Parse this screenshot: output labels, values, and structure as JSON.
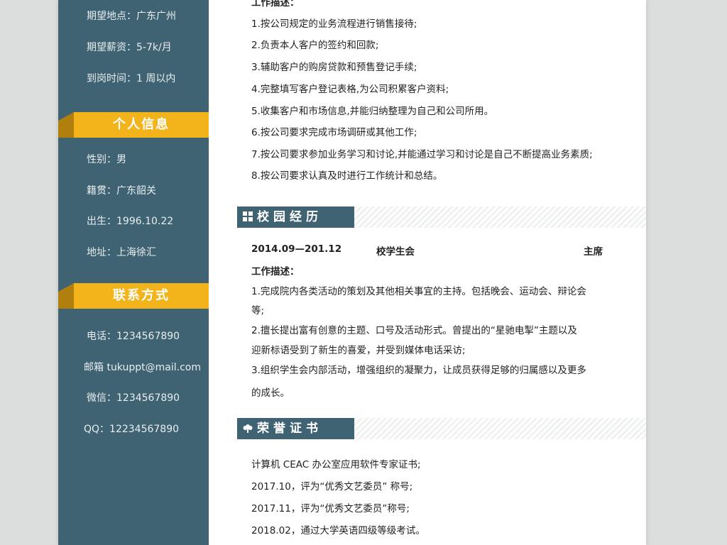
{
  "sidebar": {
    "intent": [
      "期望地点：广东广州",
      "期望薪资：5-7k/月",
      "到岗时间：1 周以内"
    ],
    "personal_title": "个人信息",
    "personal": [
      "性别：男",
      "籍贯：广东韶关",
      "出生：1996.10.22",
      "地址：上海徐汇"
    ],
    "contact_title": "联系方式",
    "contact": [
      "电话：1234567890",
      "邮箱 tukuppt@mail.com",
      "微信：1234567890",
      "QQ：12234567890"
    ]
  },
  "work": {
    "desc_title": "工作描述：",
    "items": [
      "1.按公司规定的业务流程进行销售接待;",
      "2.负责本人客户的签约和回款;",
      "3.辅助客户的购房贷款和预售登记手续;",
      "4.完整填写客户登记表格,为公司积累客户资料;",
      "5.收集客户和市场信息,并能归纳整理为自己和公司所用。",
      "6.按公司要求完成市场调研或其他工作;",
      "7.按公司要求参加业务学习和讨论,并能通过学习和讨论是自己不断提高业务素质;",
      "8.按公司要求认真及时进行工作统计和总结。"
    ]
  },
  "campus": {
    "title": "校园经历",
    "period": "2014.09—201.12",
    "org": "校学生会",
    "role": "主席",
    "desc_title": "工作描述：",
    "lines": [
      "1.完成院内各类活动的策划及其他相关事宜的主持。包括晚会、运动会、辩论会",
      "等;",
      "2.擅长提出富有创意的主题、口号及活动形式。曾提出的“星驰电掣”主题以及",
      "迎新标语受到了新生的喜爱，并受到媒体电话采访;",
      "3.组织学生会内部活动，增强组织的凝聚力，让成员获得足够的归属感以及更多",
      "的成长。"
    ]
  },
  "honors": {
    "title": "荣誉证书",
    "items": [
      "计算机 CEAC 办公室应用软件专家证书;",
      "2017.10，评为“优秀文艺委员”  称号;",
      "2017.11，评为“优秀文艺委员”称号;",
      "2018.02，通过大学英语四级等级考试。"
    ]
  }
}
